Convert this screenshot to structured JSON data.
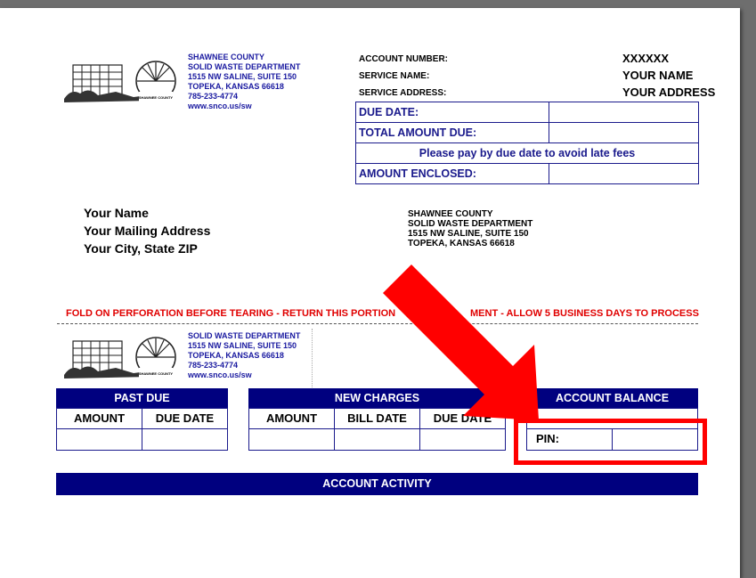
{
  "department": {
    "name1": "SHAWNEE COUNTY",
    "name2": "SOLID WASTE DEPARTMENT",
    "street": "1515 NW SALINE, SUITE 150",
    "city": "TOPEKA, KANSAS 66618",
    "phone": "785-233-4774",
    "web": "www.snco.us/sw",
    "seal_text": "SHAWNEE COUNTY KANSAS"
  },
  "account_header": {
    "number_label": "ACCOUNT NUMBER:",
    "number_value": "XXXXXX",
    "service_name_label": "SERVICE NAME:",
    "service_name_value": "YOUR NAME",
    "service_address_label": "SERVICE ADDRESS:",
    "service_address_value": "YOUR ADDRESS"
  },
  "payment_box": {
    "due_date_label": "DUE DATE:",
    "total_due_label": "TOTAL AMOUNT DUE:",
    "notice": "Please pay by due date to avoid late fees",
    "amount_enclosed_label": "AMOUNT ENCLOSED:"
  },
  "customer": {
    "name": "Your Name",
    "mailing": "Your Mailing Address",
    "city": "Your City, State ZIP"
  },
  "remit": {
    "line1": "SHAWNEE COUNTY",
    "line2": "SOLID WASTE DEPARTMENT",
    "line3": "1515 NW SALINE, SUITE 150",
    "line4": "TOPEKA, KANSAS 66618"
  },
  "fold_left": "FOLD ON PERFORATION BEFORE TEARING - RETURN THIS PORTION",
  "fold_right": "MENT - ALLOW 5 BUSINESS DAYS TO PROCESS",
  "past_due": {
    "title": "PAST DUE",
    "amount": "AMOUNT",
    "due_date": "DUE DATE"
  },
  "new_charges": {
    "title": "NEW CHARGES",
    "amount": "AMOUNT",
    "bill_date": "BILL DATE",
    "due_date": "DUE DATE"
  },
  "account_balance": {
    "title": "ACCOUNT BALANCE",
    "pin_label": "PIN:"
  },
  "account_activity": "ACCOUNT ACTIVITY",
  "colors": {
    "navy": "#00007f",
    "highlight_red": "#ff0000",
    "fold_red": "#e00000"
  }
}
